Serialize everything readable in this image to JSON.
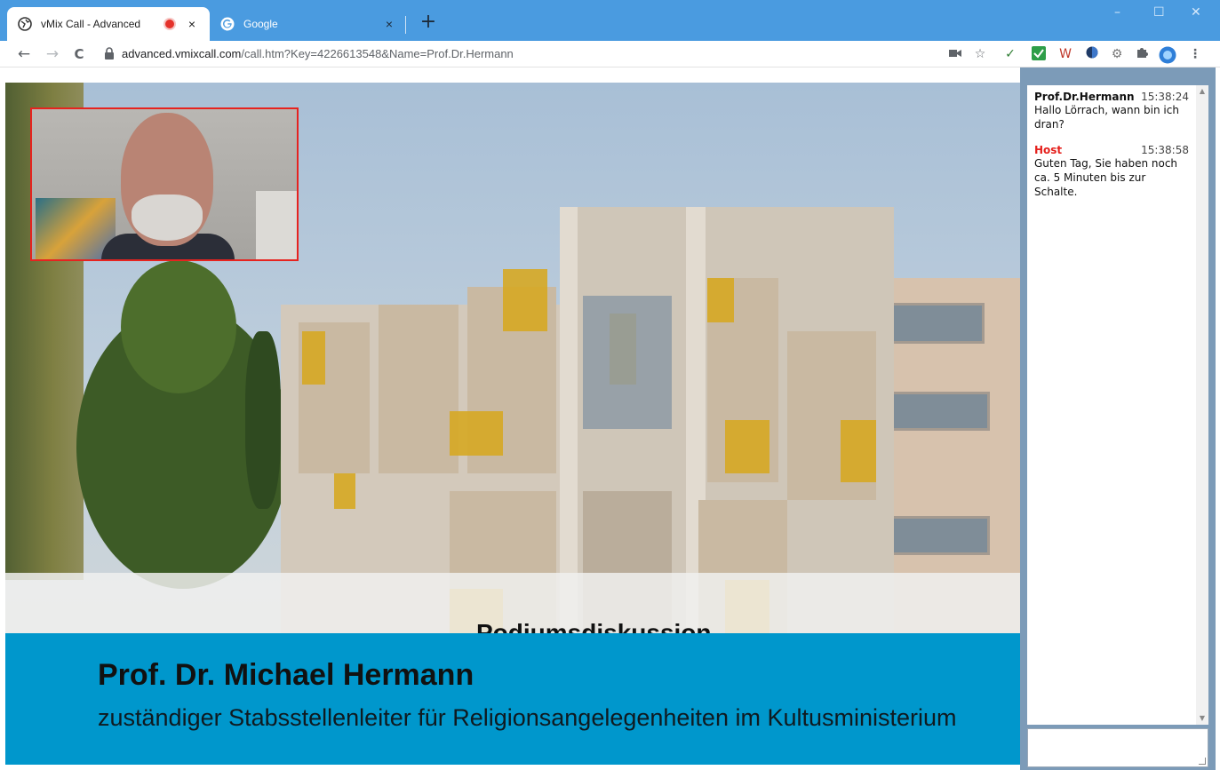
{
  "browser": {
    "tabs": [
      {
        "title": "vMix Call - Advanced",
        "recording": true,
        "close": "×"
      },
      {
        "title": "Google",
        "close": "×"
      }
    ],
    "new_tab": "+",
    "window_controls": {
      "minimize": "–",
      "maximize": "☐",
      "close": "✕"
    },
    "nav": {
      "back": "←",
      "forward": "→",
      "reload": "C"
    },
    "url_host": "advanced.vmixcall.com",
    "url_path": "/call.htm?Key=4226613548&Name=Prof.Dr.Hermann",
    "menu": "⋮"
  },
  "video": {
    "peek_title": "Podiumsdiskussion",
    "lower_third": {
      "name": "Prof. Dr. Michael Hermann",
      "role": "zuständiger Stabsstellenleiter für Religionsangelegenheiten im Kultusministerium"
    },
    "pip_border_color": "#e6231f",
    "banner_color": "#0097cc"
  },
  "chat": {
    "messages": [
      {
        "sender": "Prof.Dr.Hermann",
        "time": "15:38:24",
        "text": "Hallo Lörrach, wann bin ich dran?",
        "is_host": false
      },
      {
        "sender": "Host",
        "time": "15:38:58",
        "text": "Guten Tag, Sie haben noch ca. 5 Minuten bis zur Schalte.",
        "is_host": true
      }
    ],
    "input_value": "",
    "host_color": "#e5211d"
  }
}
